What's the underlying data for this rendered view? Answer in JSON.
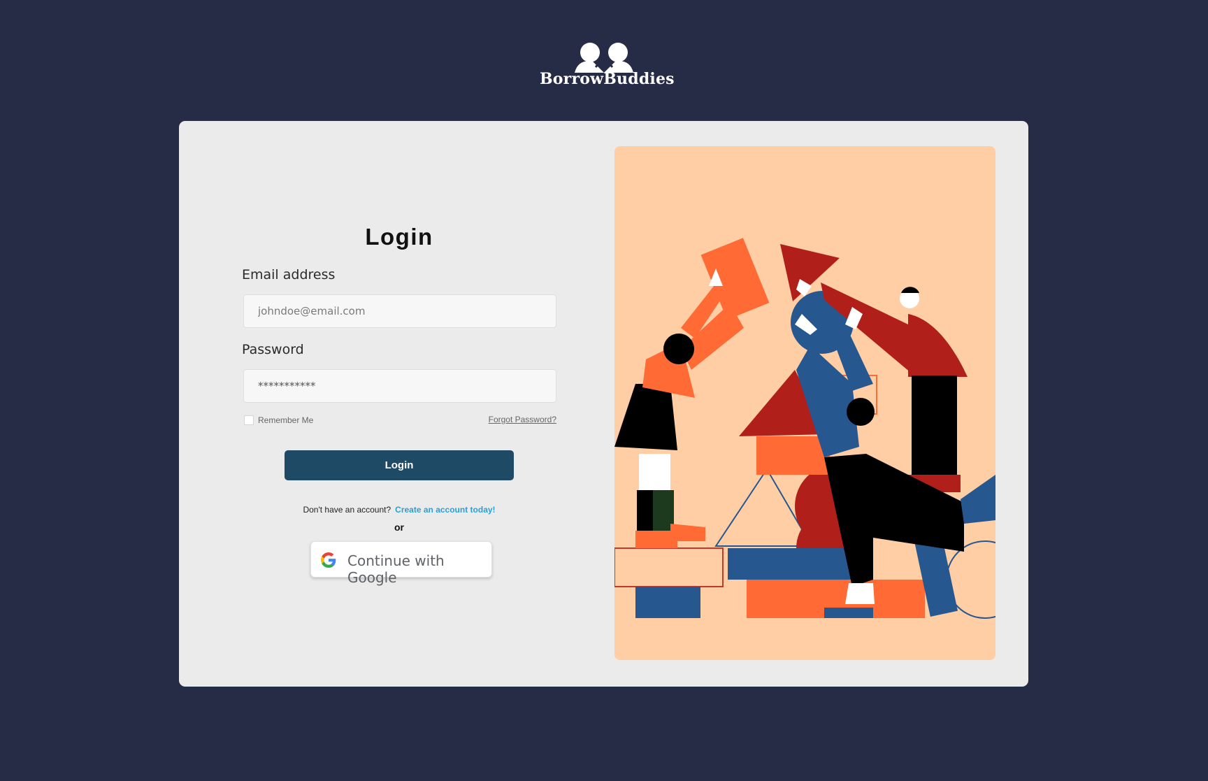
{
  "brand": {
    "name": "BorrowBuddies",
    "logo_icon": "two-people-icon"
  },
  "login": {
    "title": "Login",
    "email_label": "Email address",
    "email_placeholder": "johndoe@email.com",
    "password_label": "Password",
    "password_value": "***********",
    "remember_label": "Remember Me",
    "remember_checked": false,
    "forgot_label": "Forgot Password?",
    "submit_label": "Login",
    "no_account_text": "Don't have an account?",
    "create_account_label": "Create an account today!",
    "or_text": "or",
    "google_label": "Continue with Google"
  },
  "colors": {
    "background": "#262b46",
    "card": "#ebebeb",
    "primary_button": "#1f4a66",
    "link": "#2a9fd8",
    "illustration_bg": "#ffcea5"
  }
}
